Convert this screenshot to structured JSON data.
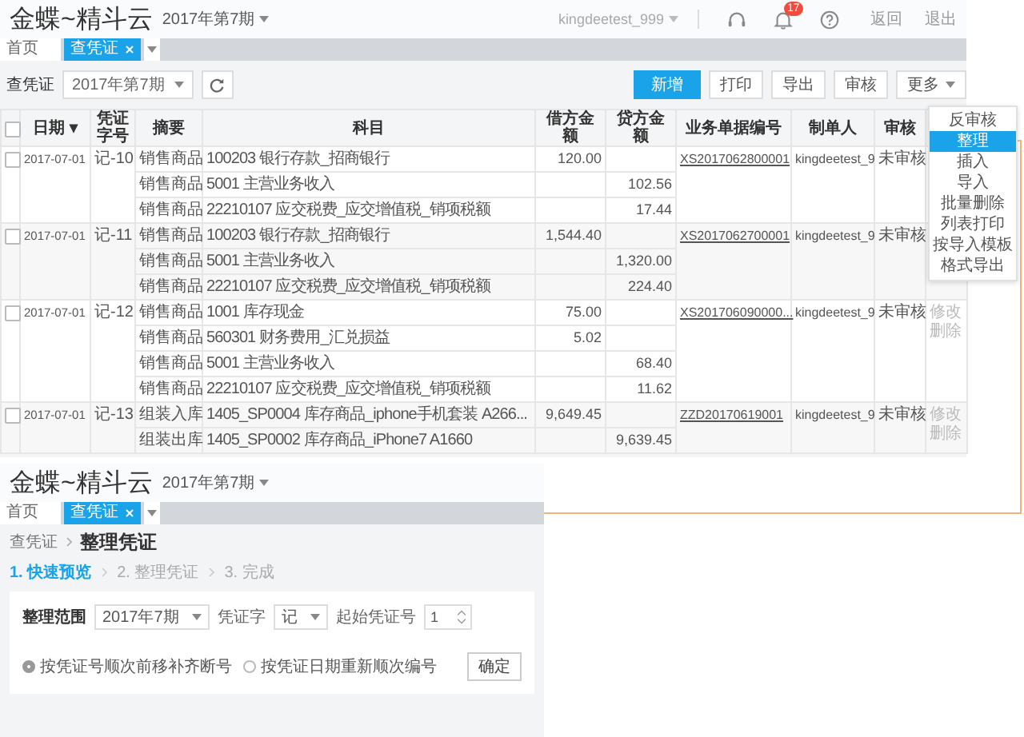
{
  "main_window": {
    "header": {
      "logo": "金蝶~精斗云",
      "period": "2017年第7期",
      "user": "kingdeetest_999",
      "notification_count": "17",
      "links": [
        "返回",
        "退出"
      ]
    },
    "tabs": [
      {
        "label": "首页",
        "selected": false,
        "closable": false
      },
      {
        "label": "查凭证",
        "selected": true,
        "closable": true
      }
    ],
    "toolbar": {
      "label": "查凭证",
      "period": "2017年第7期",
      "buttons": [
        {
          "label": "新增",
          "primary": true,
          "dropdown": false
        },
        {
          "label": "打印",
          "primary": false,
          "dropdown": false
        },
        {
          "label": "导出",
          "primary": false,
          "dropdown": false
        },
        {
          "label": "审核",
          "primary": false,
          "dropdown": false
        },
        {
          "label": "更多",
          "primary": false,
          "dropdown": true
        }
      ]
    },
    "more_menu": {
      "expanded": true,
      "items": [
        {
          "label": "反审核",
          "selected": false
        },
        {
          "label": "整理",
          "selected": true
        },
        {
          "label": "插入",
          "selected": false
        },
        {
          "label": "导入",
          "selected": false
        },
        {
          "label": "批量删除",
          "selected": false
        },
        {
          "label": "列表打印",
          "selected": false
        },
        {
          "label": "按导入模板格式导出",
          "selected": false
        }
      ]
    },
    "table": {
      "select_all_checked": false,
      "columns": [
        "日期 ▾",
        "凭证字号",
        "摘要",
        "科目",
        "借方金额",
        "贷方金额",
        "业务单据编号",
        "制单人",
        "审核"
      ],
      "vouchers": [
        {
          "checked": false,
          "date": "2017-07-01",
          "number": "记-10",
          "document": "XS2017062800001",
          "creator": "kingdeetest_9",
          "status": "未审核",
          "lines": [
            {
              "summary": "销售商品",
              "account": "100203 银行存款_招商银行",
              "debit": "120.00"
            },
            {
              "summary": "销售商品",
              "account": "5001 主营业务收入",
              "credit": "102.56"
            },
            {
              "summary": "销售商品",
              "account": "22210107 应交税费_应交增值税_销项税额",
              "credit": "17.44"
            }
          ]
        },
        {
          "checked": false,
          "date": "2017-07-01",
          "number": "记-11",
          "document": "XS2017062700001",
          "creator": "kingdeetest_9",
          "status": "未审核",
          "lines": [
            {
              "summary": "销售商品",
              "account": "100203 银行存款_招商银行",
              "debit": "1,544.40"
            },
            {
              "summary": "销售商品",
              "account": "5001 主营业务收入",
              "credit": "1,320.00"
            },
            {
              "summary": "销售商品",
              "account": "22210107 应交税费_应交增值税_销项税额",
              "credit": "224.40"
            }
          ]
        },
        {
          "checked": false,
          "date": "2017-07-01",
          "number": "记-12",
          "document": "XS201706090000...",
          "creator": "kingdeetest_9",
          "status": "未审核",
          "actions": [
            "修改",
            "删除"
          ],
          "lines": [
            {
              "summary": "销售商品",
              "account": "1001 库存现金",
              "debit": "75.00"
            },
            {
              "summary": "销售商品",
              "account": "560301 财务费用_汇兑损益",
              "debit": "5.02"
            },
            {
              "summary": "销售商品",
              "account": "5001 主营业务收入",
              "credit": "68.40"
            },
            {
              "summary": "销售商品",
              "account": "22210107 应交税费_应交增值税_销项税额",
              "credit": "11.62"
            }
          ]
        },
        {
          "checked": false,
          "date": "2017-07-01",
          "number": "记-13",
          "document": "ZZD20170619001",
          "creator": "kingdeetest_9",
          "status": "未审核",
          "actions": [
            "修改",
            "删除"
          ],
          "lines": [
            {
              "summary": "组装入库",
              "account": "1405_SP0004 库存商品_iphone手机套装 A266...",
              "debit": "9,649.45"
            },
            {
              "summary": "组装出库",
              "account": "1405_SP0002 库存商品_iPhone7 A1660",
              "credit": "9,639.45"
            }
          ]
        }
      ]
    }
  },
  "inset_window": {
    "header": {
      "logo": "金蝶~精斗云",
      "period": "2017年第7期"
    },
    "tabs": [
      {
        "label": "首页",
        "selected": false,
        "closable": false
      },
      {
        "label": "查凭证",
        "selected": true,
        "closable": true
      }
    ],
    "breadcrumb": {
      "parent": "查凭证",
      "current": "整理凭证"
    },
    "steps": [
      {
        "label": "1. 快速预览",
        "selected": true
      },
      {
        "label": "2. 整理凭证",
        "selected": false
      },
      {
        "label": "3. 完成",
        "selected": false
      }
    ],
    "form": {
      "range_label": "整理范围",
      "range_value": "2017年7期",
      "word_label": "凭证字",
      "word_value": "记",
      "start_label": "起始凭证号",
      "start_value": "1"
    },
    "options": [
      {
        "label": "按凭证号顺次前移补齐断号",
        "selected": true
      },
      {
        "label": "按凭证日期重新顺次编号",
        "selected": false
      }
    ],
    "confirm_button": "确定"
  }
}
